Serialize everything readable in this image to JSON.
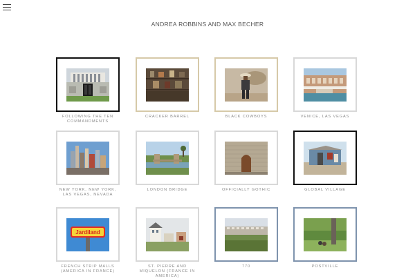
{
  "header": {
    "menu_icon": "hamburger-menu-icon",
    "title": "ANDREA ROBBINS AND MAX BECHER"
  },
  "gallery": [
    {
      "caption": "FOLLOWING THE TEN COMMANDMENTS",
      "frame_style": "black",
      "frame_color": "#111111",
      "photo": "plaza"
    },
    {
      "caption": "CRACKER BARREL",
      "frame_style": "wood",
      "frame_color": "#d6c9a8",
      "photo": "shelves"
    },
    {
      "caption": "BLACK COWBOYS",
      "frame_style": "wood",
      "frame_color": "#d6c9a8",
      "photo": "cowboy"
    },
    {
      "caption": "VENICE, LAS VEGAS",
      "frame_style": "light",
      "frame_color": "#d8d8d8",
      "photo": "venice"
    },
    {
      "caption": "NEW YORK, NEW YORK, LAS VEGAS, NEVADA",
      "frame_style": "light",
      "frame_color": "#d8d8d8",
      "photo": "skyline"
    },
    {
      "caption": "LONDON BRIDGE",
      "frame_style": "light",
      "frame_color": "#d8d8d8",
      "photo": "bridge"
    },
    {
      "caption": "OFFICIALLY GOTHIC",
      "frame_style": "light",
      "frame_color": "#d8d8d8",
      "photo": "gothic"
    },
    {
      "caption": "GLOBAL VILLAGE",
      "frame_style": "black",
      "frame_color": "#111111",
      "photo": "village"
    },
    {
      "caption": "FRENCH STRIP MALLS (AMERICA IN FRANCE)",
      "frame_style": "light",
      "frame_color": "#d8d8d8",
      "photo": "jardiland",
      "sign_text": "Jardiland"
    },
    {
      "caption": "ST. PIERRE AND MIQUELON (FRANCE IN AMERICA)",
      "frame_style": "light",
      "frame_color": "#d8d8d8",
      "photo": "houses"
    },
    {
      "caption": "770",
      "frame_style": "blue",
      "frame_color": "#7e93ad",
      "photo": "landscape"
    },
    {
      "caption": "POSTVILLE",
      "frame_style": "blue",
      "frame_color": "#7e93ad",
      "photo": "park"
    }
  ]
}
